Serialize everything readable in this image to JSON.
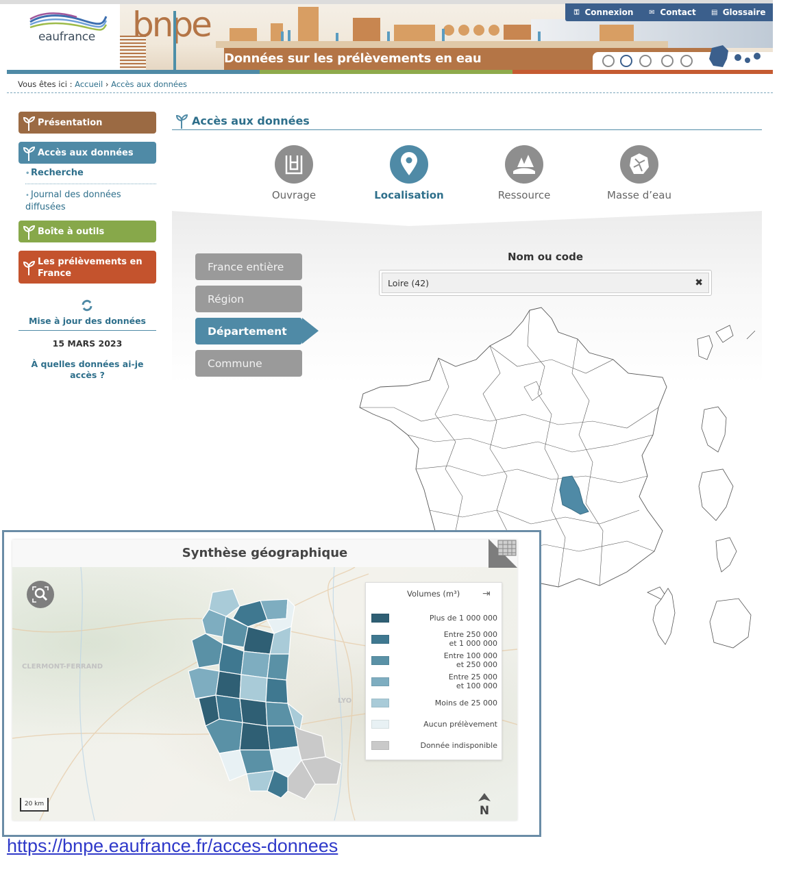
{
  "header": {
    "brand": "eaufrance",
    "logo": "bnpe",
    "banner_title": "Données sur les prélèvements en eau",
    "top_nav": [
      {
        "label": "Connexion",
        "icon": "key-icon"
      },
      {
        "label": "Contact",
        "icon": "envelope-icon"
      },
      {
        "label": "Glossaire",
        "icon": "book-icon"
      }
    ]
  },
  "breadcrumb": {
    "prefix": "Vous êtes ici :",
    "home": "Accueil",
    "sep": "›",
    "current": "Accès aux données"
  },
  "sidebar": {
    "presentation": "Présentation",
    "acces": "Accès aux données",
    "recherche": "Recherche",
    "journal": "Journal des données diffusées",
    "boite": "Boîte à outils",
    "prelevements": "Les prélèvements en France",
    "maj_title": "Mise à jour des données",
    "maj_date": "15 MARS 2023",
    "question": "À quelles données ai-je accès ?"
  },
  "main": {
    "title": "Accès aux données",
    "modes": [
      "Ouvrage",
      "Localisation",
      "Ressource",
      "Masse d’eau"
    ],
    "active_mode": "Localisation",
    "levels": [
      "France entière",
      "Région",
      "Département",
      "Commune"
    ],
    "active_level": "Département",
    "search_label": "Nom ou code",
    "search_value": "Loire (42)",
    "clear_glyph": "✖"
  },
  "synthese": {
    "title": "Synthèse géographique",
    "legend_title": "Volumes (m³)",
    "legend_close": "⇥",
    "legend": [
      {
        "label": "Plus de 1 000 000",
        "color": "#2f5f74"
      },
      {
        "label": "Entre 250 000\net 1 000 000",
        "color": "#3f7890"
      },
      {
        "label": "Entre 100 000\net 250 000",
        "color": "#5a91a6"
      },
      {
        "label": "Entre 25 000\net 100 000",
        "color": "#7eadc0"
      },
      {
        "label": "Moins de 25 000",
        "color": "#a9cbd8"
      },
      {
        "label": "Aucun prélèvement",
        "color": "#e8f1f4"
      },
      {
        "label": "Donnée indisponible",
        "color": "#c9c9c9"
      }
    ],
    "scale": "20 km",
    "north": "N",
    "bg_towns": [
      "CLERMONT-FERRAND",
      "LYO"
    ]
  },
  "footer_url": "https://bnpe.eaufrance.fr/acces-donnees",
  "colors": {
    "primary": "#4f8aa6",
    "brown": "#9b6a43",
    "green": "#87a84a",
    "red": "#c4532d",
    "nav": "#3b5f8c"
  }
}
